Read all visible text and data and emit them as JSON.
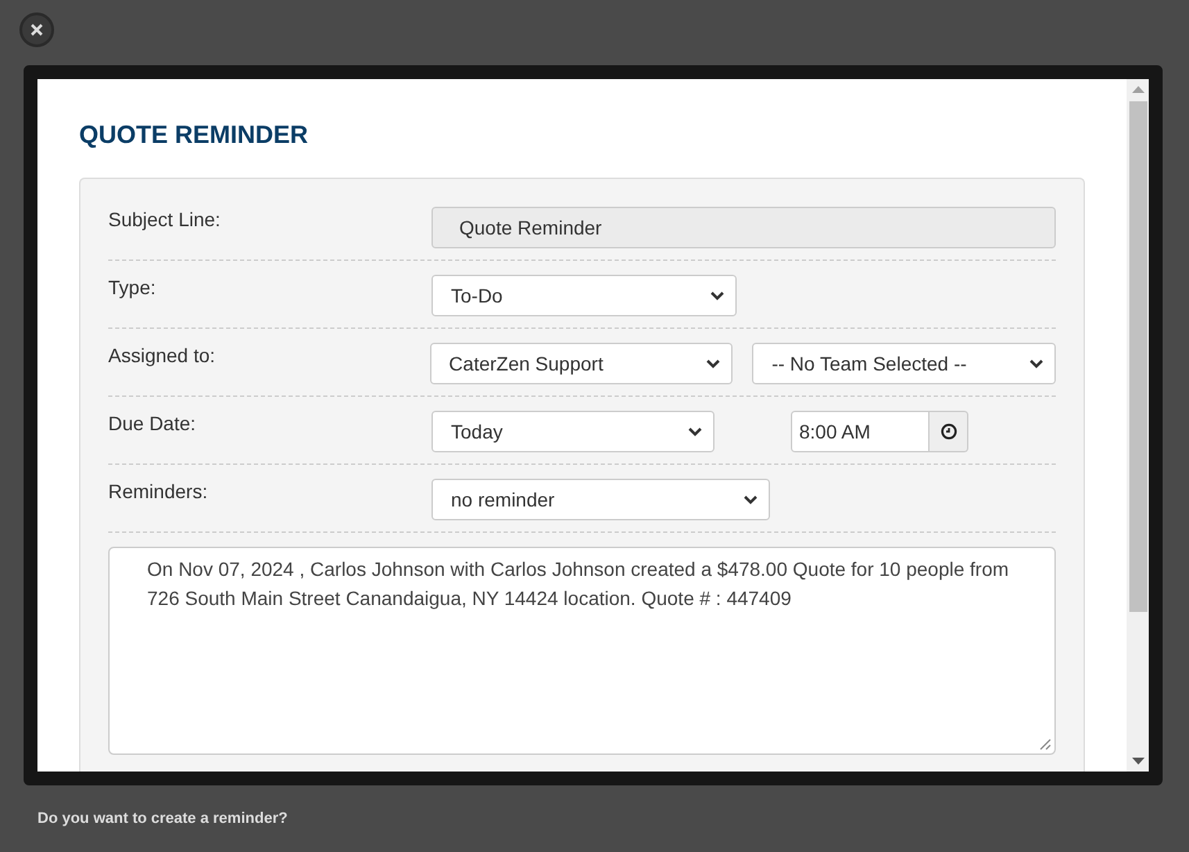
{
  "dialog": {
    "title": "QUOTE REMINDER",
    "fields": [
      {
        "kind": "readonly",
        "label": "Subject Line:",
        "value": "Quote Reminder"
      },
      {
        "kind": "select",
        "label": "Type:",
        "value": "To-Do"
      },
      {
        "kind": "select-pair",
        "label": "Assigned to:",
        "value": "CaterZen Support",
        "second_value": "-- No Team Selected --"
      },
      {
        "kind": "date-time",
        "label": "Due Date:",
        "value": "Today",
        "time": "8:00 AM"
      },
      {
        "kind": "select-wide",
        "label": "Reminders:",
        "value": "no reminder"
      }
    ],
    "note": "On Nov 07, 2024 , Carlos Johnson with Carlos Johnson created a $478.00 Quote for 10 people from 726 South Main Street Canandaigua, NY 14424 location. Quote # : 447409"
  },
  "caption": "Do you want to create a reminder?"
}
